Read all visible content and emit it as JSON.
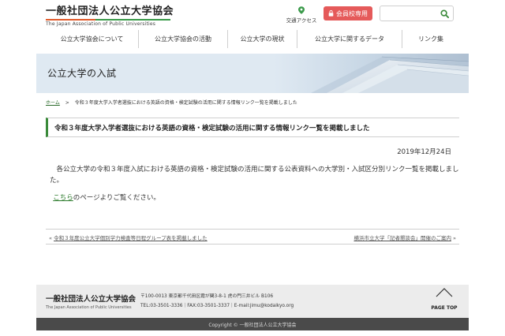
{
  "header": {
    "logo_main": "一般社団法人公立大学協会",
    "logo_sub": "The Japan Association of Public Universities",
    "access_label": "交通アクセス",
    "member_label": "会員校専用",
    "search_placeholder": ""
  },
  "nav": {
    "items": [
      {
        "label": "公立大学協会について"
      },
      {
        "label": "公立大学協会の活動"
      },
      {
        "label": "公立大学の現状"
      },
      {
        "label": "公立大学に関するデータ"
      },
      {
        "label": "リンク集"
      }
    ]
  },
  "hero": {
    "title": "公立大学の入試"
  },
  "breadcrumb": {
    "home": "ホーム",
    "separator": ">",
    "current": "令和３年度大学入学者選抜における英語の資格・検定試験の活用に関する情報リンク一覧を掲載しました"
  },
  "article": {
    "title": "令和３年度大学入学者選抜における英語の資格・検定試験の活用に関する情報リンク一覧を掲載しました",
    "date": "2019年12月24日",
    "body_text": "各公立大学の令和３年度入試における英語の資格・検定試験の活用に関する公表資料への大学別・入試区分別リンク一覧を掲載しました。",
    "link_text": "こちら",
    "link_suffix": "のページよりご覧ください。"
  },
  "pager": {
    "prev_mark": "«",
    "prev_label": "令和３年度公立大学個別学力検査等日程グループ表を掲載しました",
    "next_label": "横浜市立大学「記者懇談会」開催のご案内",
    "next_mark": "»"
  },
  "footer": {
    "logo_main": "一般社団法人公立大学協会",
    "logo_sub": "The Japan Association of Public Universities",
    "address": "〒100-0013 東京都千代田区霞が関3-8-1 虎の門三井ビル B106",
    "contact": "TEL:03-3501-3336｜FAX:03-3501-3337｜E-mail:jimu@kodaikyo.org",
    "pagetop_label": "PAGE TOP",
    "copyright": "Copyright © 一般社団法人公立大学協会"
  },
  "colors": {
    "accent_green": "#3a8a3a",
    "member_red": "#e55a5a",
    "footer_dark": "#4a4a4a"
  }
}
